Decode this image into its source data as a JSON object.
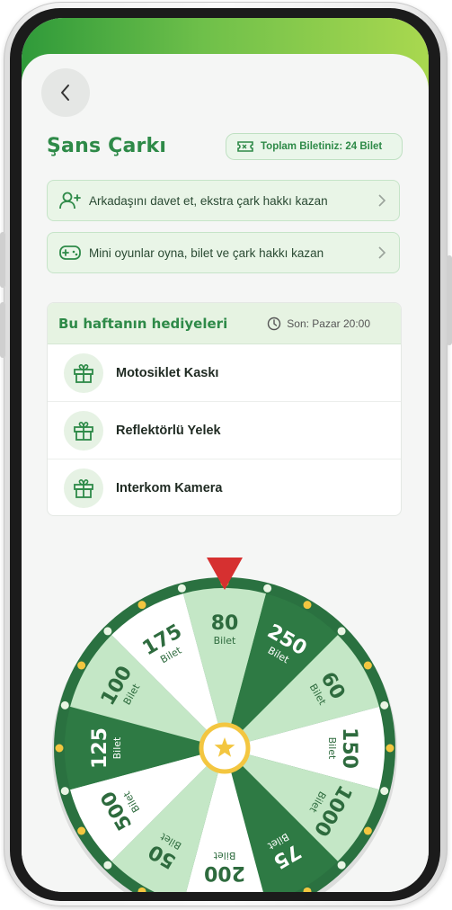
{
  "header": {
    "title": "Şans Çarkı",
    "tickets": "Toplam Biletiniz: 24 Bilet"
  },
  "actions": [
    {
      "label": "Arkadaşını davet et, ekstra çark hakkı kazan",
      "icon": "add-user-icon"
    },
    {
      "label": "Mini oyunlar oyna, bilet ve çark hakkı kazan",
      "icon": "gamepad-icon"
    }
  ],
  "gifts": {
    "title": "Bu haftanın hediyeleri",
    "deadline": "Son: Pazar 20:00",
    "items": [
      {
        "label": "Motosiklet Kaskı"
      },
      {
        "label": "Reflektörlü Yelek"
      },
      {
        "label": "Interkom Kamera"
      }
    ]
  },
  "wheel": {
    "unit": "Bilet",
    "segments": [
      "80",
      "250",
      "60",
      "150",
      "1000",
      "75",
      "200",
      "50",
      "500",
      "125",
      "100",
      "175"
    ],
    "colors": {
      "dark": "#2e7a44",
      "light": "#c4e7c6",
      "white": "#ffffff",
      "rim": "#2a7140",
      "pointer": "#d63030",
      "center": "#f3c640"
    },
    "pattern": [
      "light",
      "dark",
      "light",
      "white",
      "light",
      "dark",
      "white",
      "light",
      "white",
      "dark",
      "light",
      "white"
    ]
  }
}
